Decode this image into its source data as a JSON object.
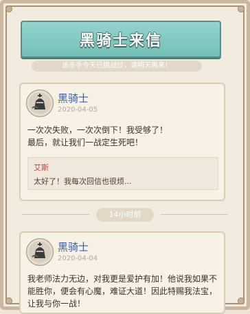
{
  "header": {
    "title": "黑骑士来信",
    "notice": "该杀手今天已挑战过，请明天再来！"
  },
  "letters": [
    {
      "sender": "黑骑士",
      "date": "2020-04-05",
      "message": "一次次失败，一次次倒下！我受够了！\n最后，就让我们一战定生死吧！",
      "reply": {
        "name": "艾斯",
        "text": "太好了！我每次回信也很烦..."
      }
    },
    {
      "sender": "黑骑士",
      "date": "2020-04-04",
      "message": "我老师法力无边，对我更是爱护有加！他说我如果不能胜你，便会有心魔，难证大道！因此特赐我法宝，让我与你一战！"
    }
  ],
  "divider": {
    "time_ago": "14小时前"
  },
  "colors": {
    "banner": "#7fc6be",
    "sender_name": "#3a5cae",
    "reply_name": "#c3433b",
    "paper": "#f2ebdf"
  },
  "icons": {
    "avatar": "black-knight-avatar-icon"
  }
}
